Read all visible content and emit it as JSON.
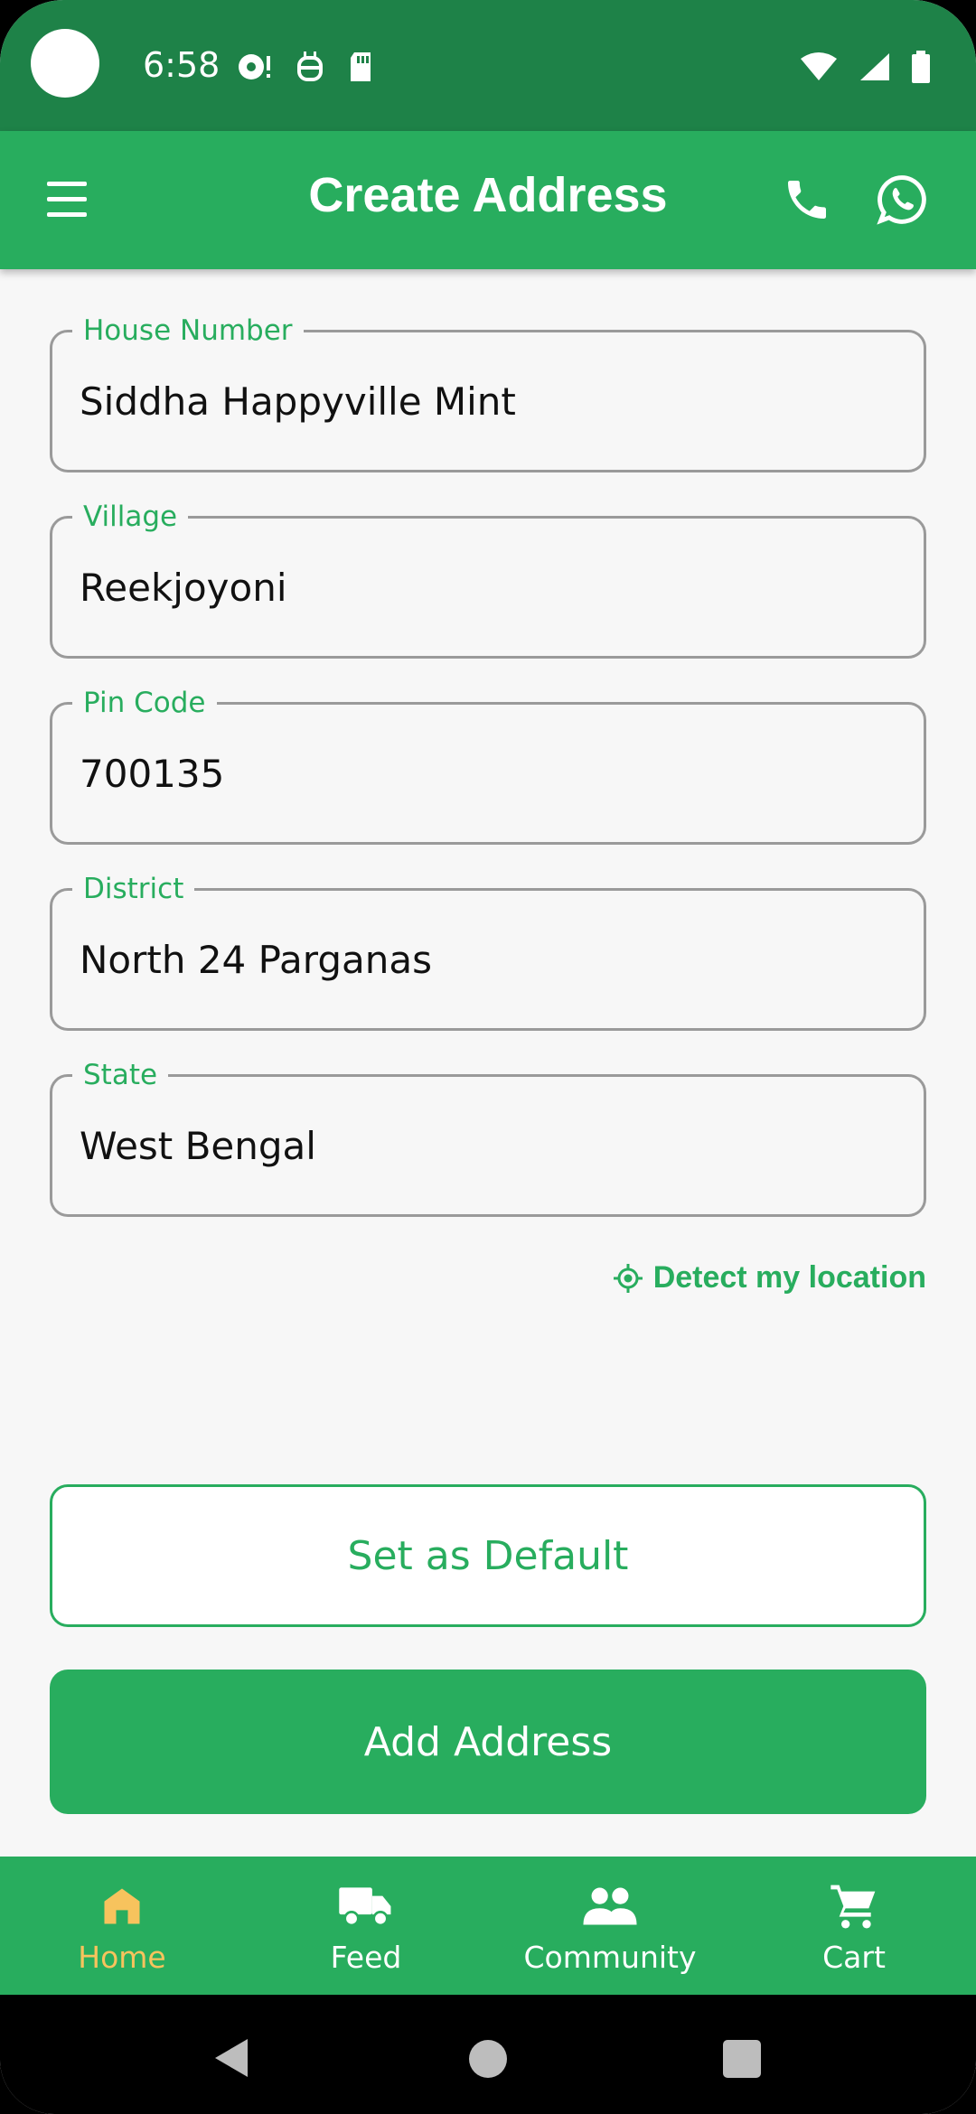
{
  "status_bar": {
    "time": "6:58",
    "icons_left": [
      "sync-alert-icon",
      "android-debug-icon",
      "sd-card-icon"
    ],
    "icons_right": [
      "wifi-icon",
      "signal-icon",
      "battery-icon"
    ]
  },
  "app_bar": {
    "title": "Create Address",
    "icons": [
      "menu-icon",
      "phone-icon",
      "whatsapp-icon"
    ]
  },
  "form": {
    "fields": [
      {
        "label": "House Number",
        "value": "Siddha Happyville Mint"
      },
      {
        "label": "Village",
        "value": "Reekjoyoni"
      },
      {
        "label": "Pin Code",
        "value": "700135"
      },
      {
        "label": "District",
        "value": "North 24 Parganas"
      },
      {
        "label": "State",
        "value": "West Bengal"
      }
    ],
    "detect_location": "Detect my location"
  },
  "buttons": {
    "set_default": "Set as Default",
    "add_address": "Add Address"
  },
  "bottom_nav": {
    "items": [
      {
        "label": "Home",
        "icon": "home-icon",
        "active": true
      },
      {
        "label": "Feed",
        "icon": "truck-icon",
        "active": false
      },
      {
        "label": "Community",
        "icon": "people-icon",
        "active": false
      },
      {
        "label": "Cart",
        "icon": "cart-icon",
        "active": false
      }
    ]
  },
  "colors": {
    "primary": "#28ad5e",
    "status_bar": "#1e8248",
    "active_nav": "#f7c35d",
    "background": "#f7f7f7"
  }
}
